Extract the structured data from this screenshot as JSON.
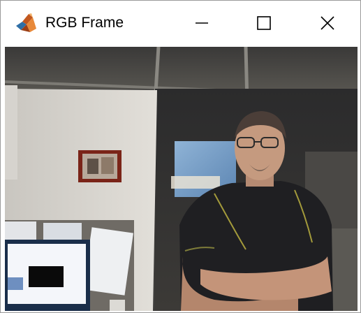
{
  "window": {
    "title": "RGB Frame",
    "app_icon": "matlab-logo-icon",
    "controls": {
      "minimize_icon": "minimize-icon",
      "maximize_icon": "maximize-icon",
      "close_icon": "close-icon"
    }
  },
  "frame": {
    "content": "camera-rgb-frame"
  },
  "colors": {
    "titlebar_bg": "#ffffff",
    "window_border": "#9a9a9a",
    "icon_stroke": "#000000"
  }
}
